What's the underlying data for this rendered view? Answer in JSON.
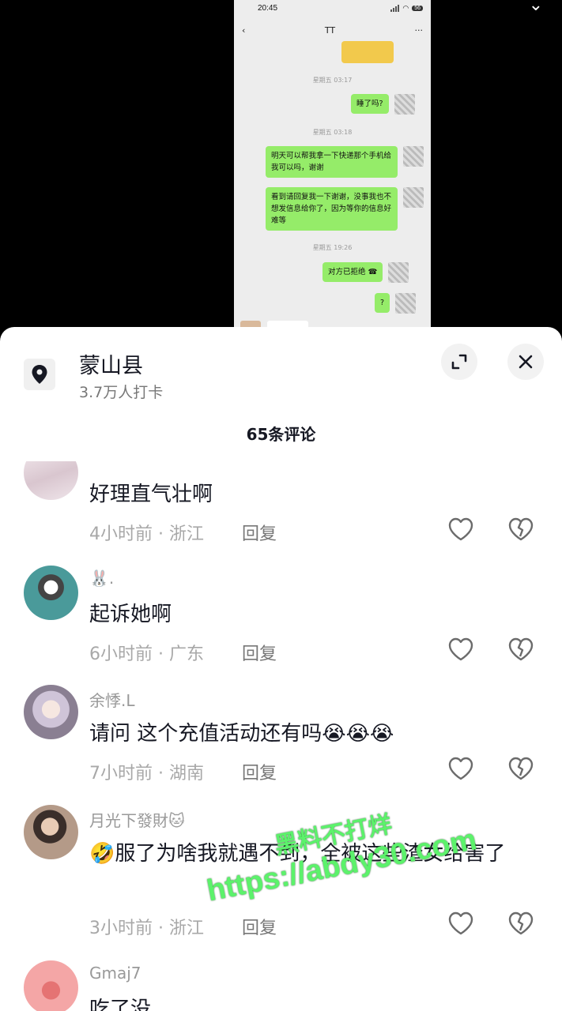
{
  "chat_screenshot": {
    "status_time": "20:45",
    "battery": "56",
    "contact_name": "TT",
    "timestamps": [
      "星期五 03:17",
      "星期五 03:18",
      "星期五 19:26"
    ],
    "messages": [
      "睡了吗?",
      "明天可以帮我拿一下快递那个手机给我可以吗，谢谢",
      "看到请回复我一下谢谢，没事我也不想发信息给你了，因为等你的信息好难等",
      "对方已拒绝",
      "?"
    ]
  },
  "location": {
    "name": "蒙山县",
    "checkins": "3.7万人打卡"
  },
  "comments_header": "65条评论",
  "reply_label": "回复",
  "comments": [
    {
      "user": "",
      "text": "好理直气壮啊",
      "meta": "4小时前 · 浙江"
    },
    {
      "user": "🐰.",
      "text": "起诉她啊",
      "meta": "6小时前 · 广东"
    },
    {
      "user": "余悸.L",
      "text": "请问 这个充值活动还有吗😭😭😭",
      "meta": "7小时前 · 湖南"
    },
    {
      "user": "月光下發財🐱",
      "text": "🤣服了为啥我就遇不到，全被这些渣女给害了",
      "meta": "3小时前 · 浙江"
    },
    {
      "user": "Gmaj7",
      "text": "吃了没",
      "meta": ""
    }
  ],
  "watermark": {
    "line1": "黑料不打烊",
    "line2": "https://abdy30.com"
  },
  "colors": {
    "bubble": "#95ec69",
    "sheet_bg": "#ffffff",
    "watermark": "#5cf26b"
  }
}
